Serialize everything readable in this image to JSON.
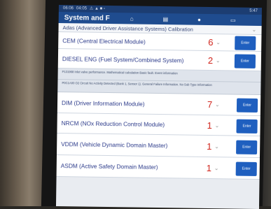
{
  "statusbar": {
    "time": "06:06",
    "clock": "04:05",
    "right": "5:47"
  },
  "header": {
    "title": "System and F"
  },
  "adas_row": {
    "label": "Adas (Advanced Driver Assistance Systems) Calibration"
  },
  "modules": [
    {
      "label": "CEM (Central Electrical Module)",
      "count": "6",
      "enter": "Enter"
    },
    {
      "label": "DIESEL ENG (Fuel System/Combined System)",
      "count": "2",
      "enter": "Enter"
    }
  ],
  "dtc_lines": [
    "P131968 Inlet valve performance. Mathematical calculation Basic fault. Event information",
    "P0C1A00 O2 Circuit No Activity Detected (Bank 1, Sensor 1). General Failure Information. No Sub Type Information"
  ],
  "modules2": [
    {
      "label": "DIM (Driver Information Module)",
      "count": "7",
      "enter": "Enter"
    },
    {
      "label": "NRCM (NOx Reduction Control Module)",
      "count": "1",
      "enter": "Enter"
    },
    {
      "label": "VDDM (Vehicle Dynamic Domain Master)",
      "count": "1",
      "enter": "Enter"
    },
    {
      "label": "ASDM (Active Safety Domain Master)",
      "count": "1",
      "enter": "Enter"
    }
  ]
}
